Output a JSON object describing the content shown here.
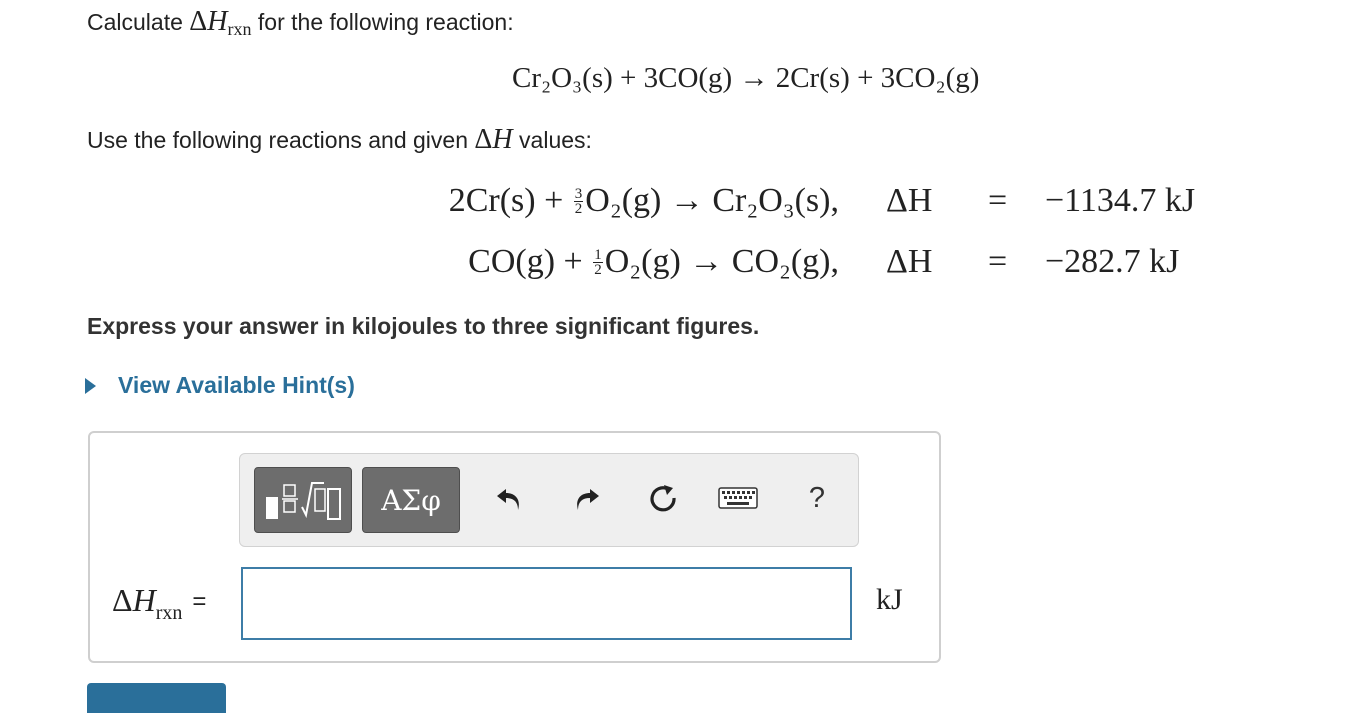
{
  "question": {
    "calc_prefix": "Calculate ",
    "delta": "Δ",
    "H": "H",
    "rxn": "rxn",
    "calc_suffix": " for the following reaction:",
    "main_equation": "Cr₂O₃(s) + 3CO(g) → 2Cr(s) + 3CO₂(g)",
    "use_prefix": "Use the following reactions and given ",
    "use_suffix": " values:",
    "reactions": [
      {
        "left_a": "2Cr(s) + ",
        "frac_num": "3",
        "frac_den": "2",
        "left_b": "O₂(g) → Cr₂O₃(s),",
        "dh": "ΔH",
        "eq": "=",
        "value": "−1134.7 kJ"
      },
      {
        "left_a": "CO(g) + ",
        "frac_num": "1",
        "frac_den": "2",
        "left_b": "O₂(g) → CO₂(g),",
        "dh": "ΔH",
        "eq": "=",
        "value": "−282.7 kJ"
      }
    ],
    "instruction": "Express your answer in kilojoules to three significant figures."
  },
  "hint": {
    "label": "View Available Hint(s)"
  },
  "toolbar": {
    "template_icon": "template-icon",
    "greek_label": "ΑΣφ",
    "undo_icon": "undo-icon",
    "redo_icon": "redo-icon",
    "reset_icon": "reset-icon",
    "keyboard_icon": "keyboard-icon",
    "help_label": "?"
  },
  "answer": {
    "label_delta": "Δ",
    "label_H": "H",
    "label_sub": "rxn",
    "label_eq": "=",
    "value": "",
    "unit": "kJ"
  },
  "colors": {
    "link": "#2a6f9a",
    "input_border": "#3d7da7",
    "toolbar_button": "#6d6d6d"
  }
}
